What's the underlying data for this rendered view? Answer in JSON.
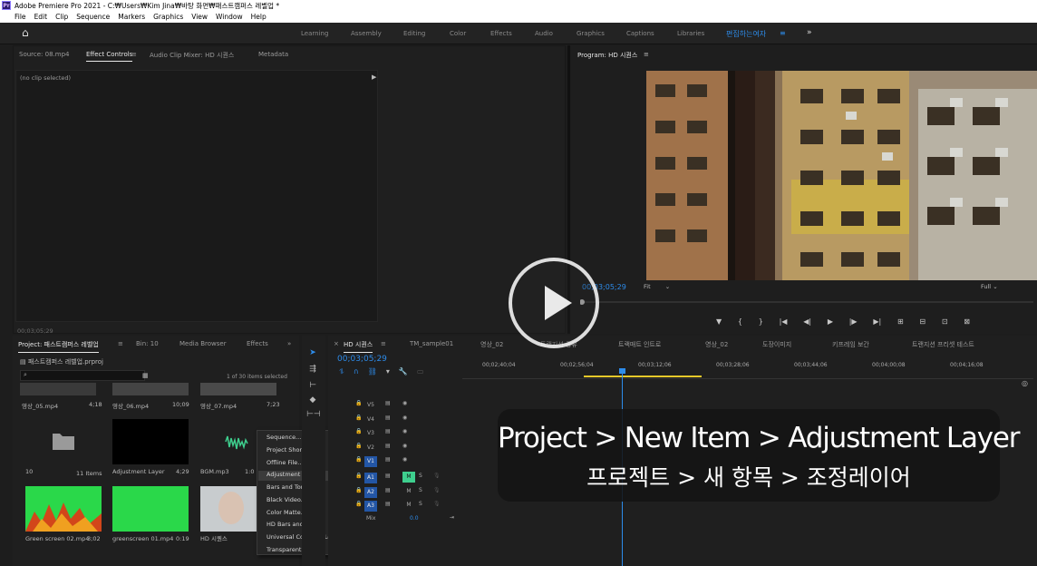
{
  "window": {
    "title": "Adobe Premiere Pro 2021 - C:₩Users₩Kim Jina₩바탕 화면₩패스트캠퍼스 레벨업 *",
    "app_icon": "Pr"
  },
  "menu": [
    "File",
    "Edit",
    "Clip",
    "Sequence",
    "Markers",
    "Graphics",
    "View",
    "Window",
    "Help"
  ],
  "workspaces": {
    "tabs": [
      "Learning",
      "Assembly",
      "Editing",
      "Color",
      "Effects",
      "Audio",
      "Graphics",
      "Captions",
      "Libraries"
    ],
    "active": "편집하는여자",
    "active_menu_icon": "≡",
    "more": "»"
  },
  "source_panel": {
    "tabs": [
      "Source: 08.mp4",
      "Effect Controls",
      "Audio Clip Mixer: HD 시퀀스",
      "Metadata"
    ],
    "active_tab": "Effect Controls",
    "menu_icon": "≡",
    "no_clip": "(no clip selected)",
    "timecode": "00;03;05;29"
  },
  "program_panel": {
    "title": "Program: HD 시퀀스",
    "menu_icon": "≡",
    "timecode": "00;03;05;29",
    "fit": "Fit",
    "resolution": "Full",
    "transport": [
      "▼",
      "{",
      "}",
      "|◀",
      "◀|",
      "▶",
      "|▶",
      "▶|",
      "⊞",
      "⊟",
      "⊡",
      "⊠"
    ]
  },
  "project_panel": {
    "tabs": [
      "Project: 패스트캠퍼스 레벨업",
      "Bin: 10",
      "Media Browser",
      "Effects"
    ],
    "menu_icon": "≡",
    "more": "»",
    "file": "패스트캠퍼스 레벨업.prproj",
    "search_placeholder": "",
    "count": "1 of 30 items selected",
    "top_row": [
      {
        "name": "영상_05.mp4",
        "duration": "4;18"
      },
      {
        "name": "영상_06.mp4",
        "duration": "10;09"
      },
      {
        "name": "영상_07.mp4",
        "duration": "7;23"
      }
    ],
    "mid_row": [
      {
        "name": "10",
        "duration": "11 Items"
      },
      {
        "name": "Adjustment Layer",
        "duration": "4;29"
      },
      {
        "name": "BGM.mp3",
        "duration": "1:0"
      }
    ],
    "bottom_row": [
      {
        "name": "Green screen 02.mp4",
        "duration": "3;02"
      },
      {
        "name": "greenscreen 01.mp4",
        "duration": "0:19"
      },
      {
        "name": "HD 시퀀스",
        "duration": ""
      }
    ]
  },
  "context_menu": {
    "items": [
      "Sequence...",
      "Project Shortcut...",
      "Offline File...",
      "Adjustment Layer...",
      "Bars and Tone...",
      "Black Video...",
      "Color Matte...",
      "HD Bars and Tone...",
      "Universal Counting Leader...",
      "Transparent Video..."
    ],
    "highlighted": "Adjustment Layer..."
  },
  "timeline": {
    "tabs": [
      "HD 시퀀스",
      "TM_sample01",
      "영상_02",
      "트랜지션 공유",
      "트랙매트 인트로",
      "영상_02",
      "도장이미지",
      "키프레임 보간",
      "트랜지션 프리셋 테스트"
    ],
    "active_tab": "HD 시퀀스",
    "menu_icon": "≡",
    "close_icon": "×",
    "timecode": "00;03;05;29",
    "ruler": [
      "00;02;40;04",
      "00;02;56;04",
      "00;03;12;06",
      "00;03;28;06",
      "00;03;44;06",
      "00;04;00;08",
      "00;04;16;08"
    ],
    "video_tracks": [
      "V5",
      "V4",
      "V3",
      "V2",
      "V1"
    ],
    "audio_tracks": [
      "A1",
      "A2",
      "A3"
    ],
    "mute_label": "M",
    "solo_label": "S",
    "mix_label": "Mix",
    "mix_value": "0.0"
  },
  "caption": {
    "english": "Project > New Item > Adjustment Layer",
    "korean": "프로젝트 > 새 항목 > 조정레이어"
  },
  "colors": {
    "accent_blue": "#2d8ceb",
    "track_blue": "#2356a6",
    "mute_green": "#3ecf8e",
    "workarea_yellow": "#e6c82a"
  }
}
